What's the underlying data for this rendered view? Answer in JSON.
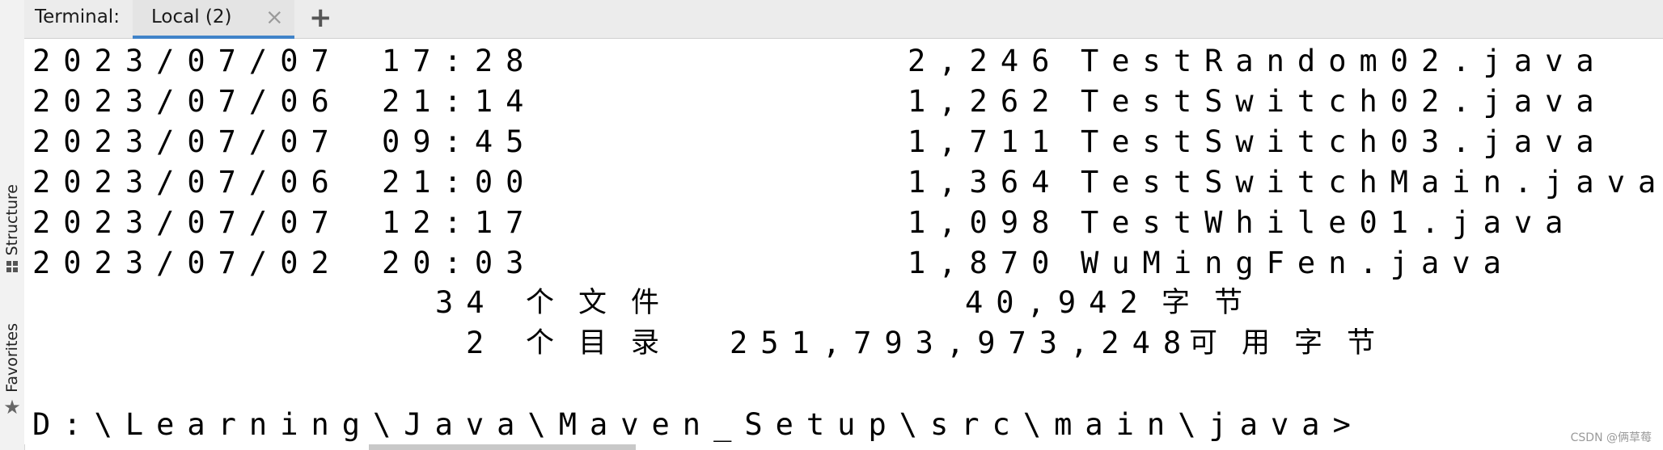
{
  "left_tools": {
    "structure_label": "Structure",
    "favorites_label": "Favorites",
    "favorites_glyph": "★"
  },
  "tab_bar": {
    "title": "Terminal:",
    "tab_label": "Local (2)",
    "close_glyph": "×",
    "add_glyph": "+",
    "accent_color": "#4083c9"
  },
  "listing": [
    {
      "date": "2023/07/07",
      "time": "17:28",
      "size": "2,246",
      "name": "TestRandom02.java"
    },
    {
      "date": "2023/07/06",
      "time": "21:14",
      "size": "1,262",
      "name": "TestSwitch02.java"
    },
    {
      "date": "2023/07/07",
      "time": "09:45",
      "size": "1,711",
      "name": "TestSwitch03.java"
    },
    {
      "date": "2023/07/06",
      "time": "21:00",
      "size": "1,364",
      "name": "TestSwitchMain.java"
    },
    {
      "date": "2023/07/07",
      "time": "12:17",
      "size": "1,098",
      "name": "TestWhile01.java"
    },
    {
      "date": "2023/07/02",
      "time": "20:03",
      "size": "1,870",
      "name": "WuMingFen.java"
    }
  ],
  "summary": {
    "file_count": "34",
    "file_label": "个文件",
    "total_bytes": "40,942",
    "bytes_unit": "字节"
  },
  "dirs": {
    "dir_count": "2",
    "dir_label": "个目录",
    "free_bytes": "251,793,973,248",
    "free_unit": "可用字节"
  },
  "prompt": "D:\\Learning\\Java\\Maven_Setup\\src\\main\\java>",
  "watermark": "CSDN @俩草莓"
}
